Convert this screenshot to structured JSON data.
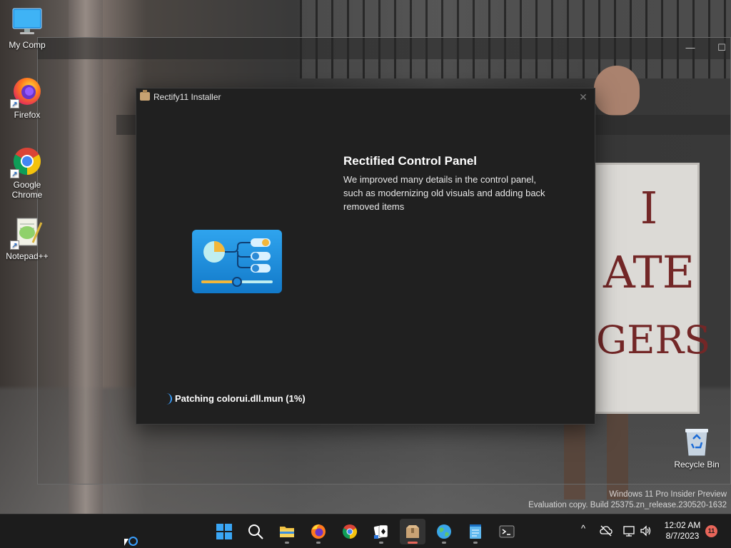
{
  "desktop": {
    "icons": [
      {
        "label": "My Comp",
        "icon": "monitor-icon"
      },
      {
        "label": "Firefox",
        "icon": "firefox-icon"
      },
      {
        "label": "Google Chrome",
        "icon": "chrome-icon"
      },
      {
        "label": "Notepad++",
        "icon": "notepadpp-icon"
      }
    ],
    "recycle_bin": {
      "label": "Recycle Bin",
      "icon": "recycle-bin-icon"
    }
  },
  "wallpaper": {
    "sign_lines": [
      "I",
      "ATE",
      "GERS"
    ]
  },
  "installer": {
    "title": "Rectify11 Installer",
    "close_label": "✕",
    "feature_title": "Rectified Control Panel",
    "feature_description": "We improved many details in the control panel, such as modernizing old visuals and adding back removed items",
    "status_text": "Patching colorui.dll.mun (1%)",
    "progress_percent": 1,
    "feature_icon": "control-panel-icon"
  },
  "watermark": {
    "line1": "Windows 11 Pro Insider Preview",
    "line2": "Evaluation copy. Build 25375.zn_release.230520-1632"
  },
  "taskbar": {
    "apps": [
      {
        "name": "start",
        "icon": "windows-start-icon"
      },
      {
        "name": "search",
        "icon": "search-icon"
      },
      {
        "name": "file-explorer",
        "icon": "folder-icon"
      },
      {
        "name": "firefox",
        "icon": "firefox-icon"
      },
      {
        "name": "chrome",
        "icon": "chrome-icon"
      },
      {
        "name": "solitaire",
        "icon": "cards-icon"
      },
      {
        "name": "rectify11-installer",
        "icon": "installer-box-icon"
      },
      {
        "name": "maps",
        "icon": "globe-icon"
      },
      {
        "name": "notepad",
        "icon": "notepad-icon"
      },
      {
        "name": "terminal",
        "icon": "terminal-icon"
      }
    ],
    "tray": {
      "chevron": "^",
      "time": "12:02 AM",
      "date": "8/7/2023",
      "notification_count": "11"
    }
  },
  "colors": {
    "accent": "#3aa0ff",
    "dialog_bg": "#202020",
    "taskbar_bg": "#1c1c1c",
    "badge": "#e8665a"
  }
}
